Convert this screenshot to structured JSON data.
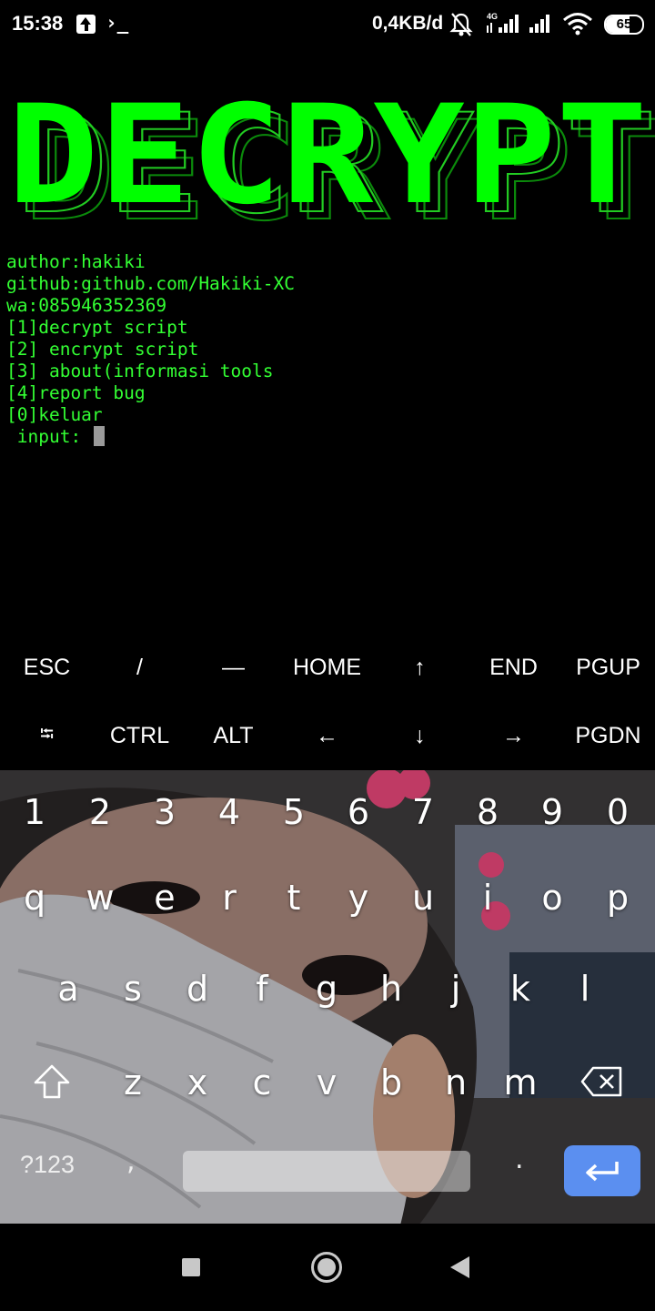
{
  "status_bar": {
    "time": "15:38",
    "terminal_glyph": "›_",
    "net_speed": "0,4KB/d",
    "signal_label": "4G",
    "battery": "65"
  },
  "banner": {
    "text": "DECRYPT",
    "color": "#00ff00"
  },
  "terminal": {
    "lines": [
      "author:hakiki",
      "github:github.com/Hakiki-XC",
      "wa:085946352369",
      "[1]decrypt script",
      "[2] encrypt script",
      "[3] about(informasi tools",
      "[4]report bug",
      "[0]keluar"
    ],
    "prompt": " input: "
  },
  "extra_keys": {
    "row1": [
      "ESC",
      "/",
      "—",
      "HOME",
      "↑",
      "END",
      "PGUP"
    ],
    "row2": [
      "⭾",
      "CTRL",
      "ALT",
      "←",
      "↓",
      "→",
      "PGDN"
    ]
  },
  "keyboard": {
    "numbers": [
      "1",
      "2",
      "3",
      "4",
      "5",
      "6",
      "7",
      "8",
      "9",
      "0"
    ],
    "row1": [
      "q",
      "w",
      "e",
      "r",
      "t",
      "y",
      "u",
      "i",
      "o",
      "p"
    ],
    "row2": [
      "a",
      "s",
      "d",
      "f",
      "g",
      "h",
      "j",
      "k",
      "l"
    ],
    "row3": [
      "z",
      "x",
      "c",
      "v",
      "b",
      "n",
      "m"
    ],
    "symbols_label": "?123",
    "comma": ",",
    "period": ".",
    "enter_color": "#5b8ff0"
  }
}
